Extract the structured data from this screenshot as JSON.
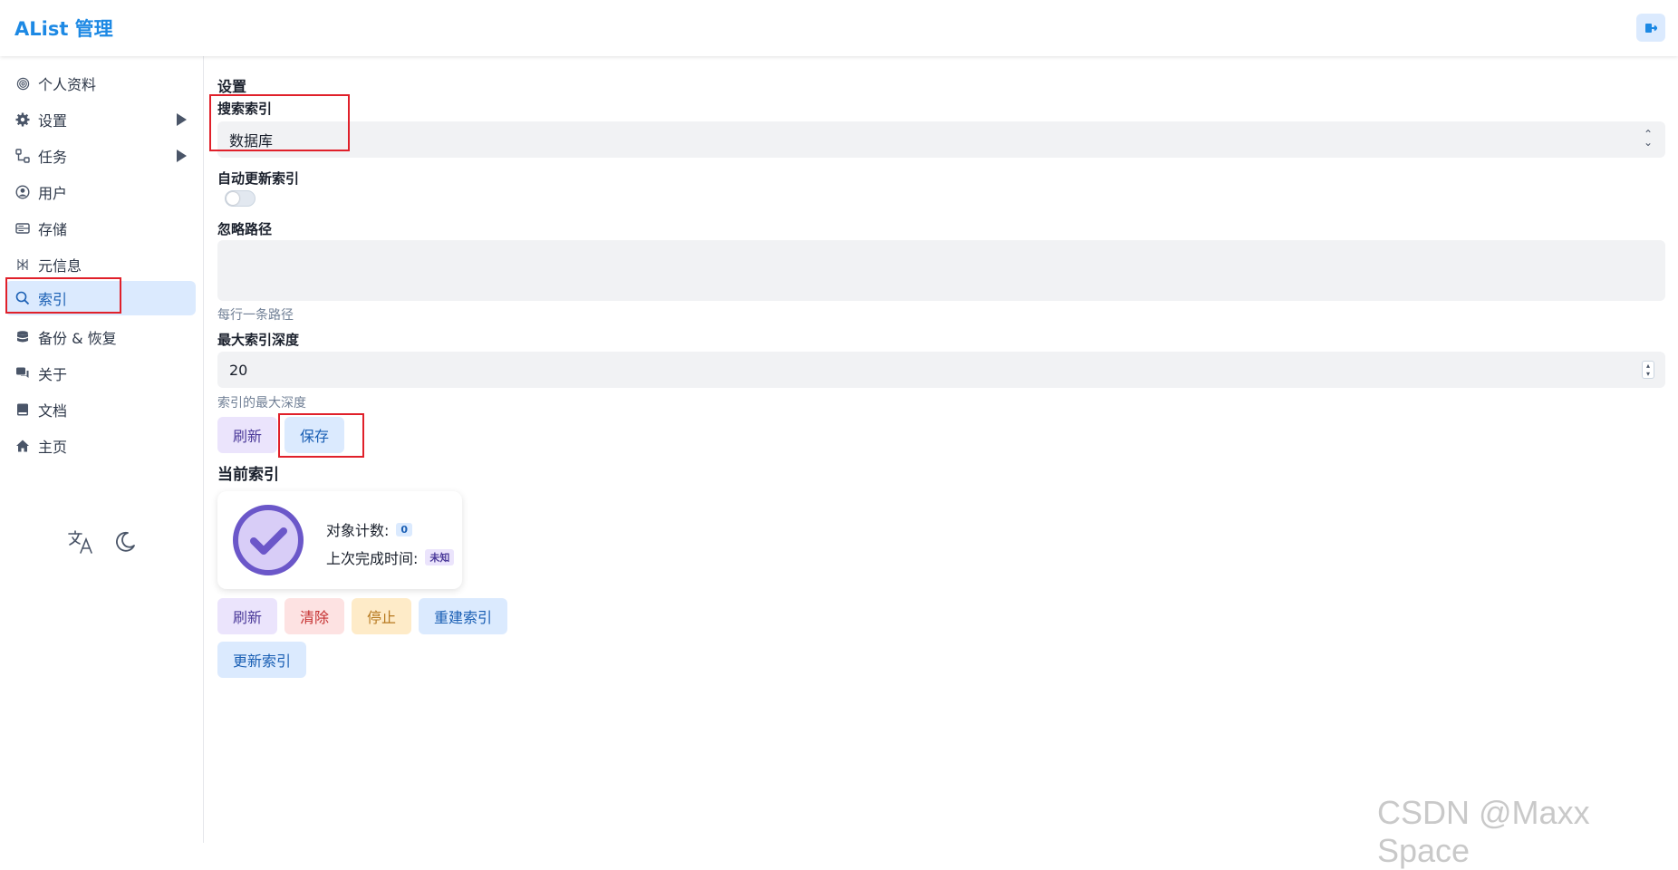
{
  "app": {
    "title": "AList 管理"
  },
  "sidebar": {
    "items": [
      {
        "label": "个人资料",
        "icon": "fingerprint-icon"
      },
      {
        "label": "设置",
        "icon": "gear-icon"
      },
      {
        "label": "任务",
        "icon": "tasks-icon"
      },
      {
        "label": "用户",
        "icon": "user-circle-icon"
      },
      {
        "label": "存储",
        "icon": "storage-icon"
      },
      {
        "label": "元信息",
        "icon": "meta-icon"
      },
      {
        "label": "索引",
        "icon": "search-icon"
      },
      {
        "label": "备份 & 恢复",
        "icon": "database-icon"
      },
      {
        "label": "关于",
        "icon": "chat-icon"
      },
      {
        "label": "文档",
        "icon": "book-icon"
      },
      {
        "label": "主页",
        "icon": "home-icon"
      }
    ],
    "active": "索引"
  },
  "main": {
    "title": "设置",
    "search_index": {
      "label": "搜索索引",
      "value": "数据库"
    },
    "auto_update": {
      "label": "自动更新索引",
      "enabled": false
    },
    "ignore_paths": {
      "label": "忽略路径",
      "value": "",
      "hint": "每行一条路径"
    },
    "max_depth": {
      "label": "最大索引深度",
      "value": "20",
      "hint": "索引的最大深度"
    },
    "buttons": {
      "refresh": "刷新",
      "save": "保存"
    },
    "current_index": {
      "title": "当前索引",
      "object_count_label": "对象计数:",
      "object_count": "0",
      "last_done_label": "上次完成时间:",
      "last_done": "未知"
    },
    "actions": {
      "refresh": "刷新",
      "clear": "清除",
      "stop": "停止",
      "rebuild": "重建索引",
      "update": "更新索引"
    }
  },
  "watermark": "CSDN @Maxx Space",
  "colors": {
    "brand": "#1d89e4",
    "active_bg": "#dbeafe",
    "highlight_box": "#e0202a"
  }
}
